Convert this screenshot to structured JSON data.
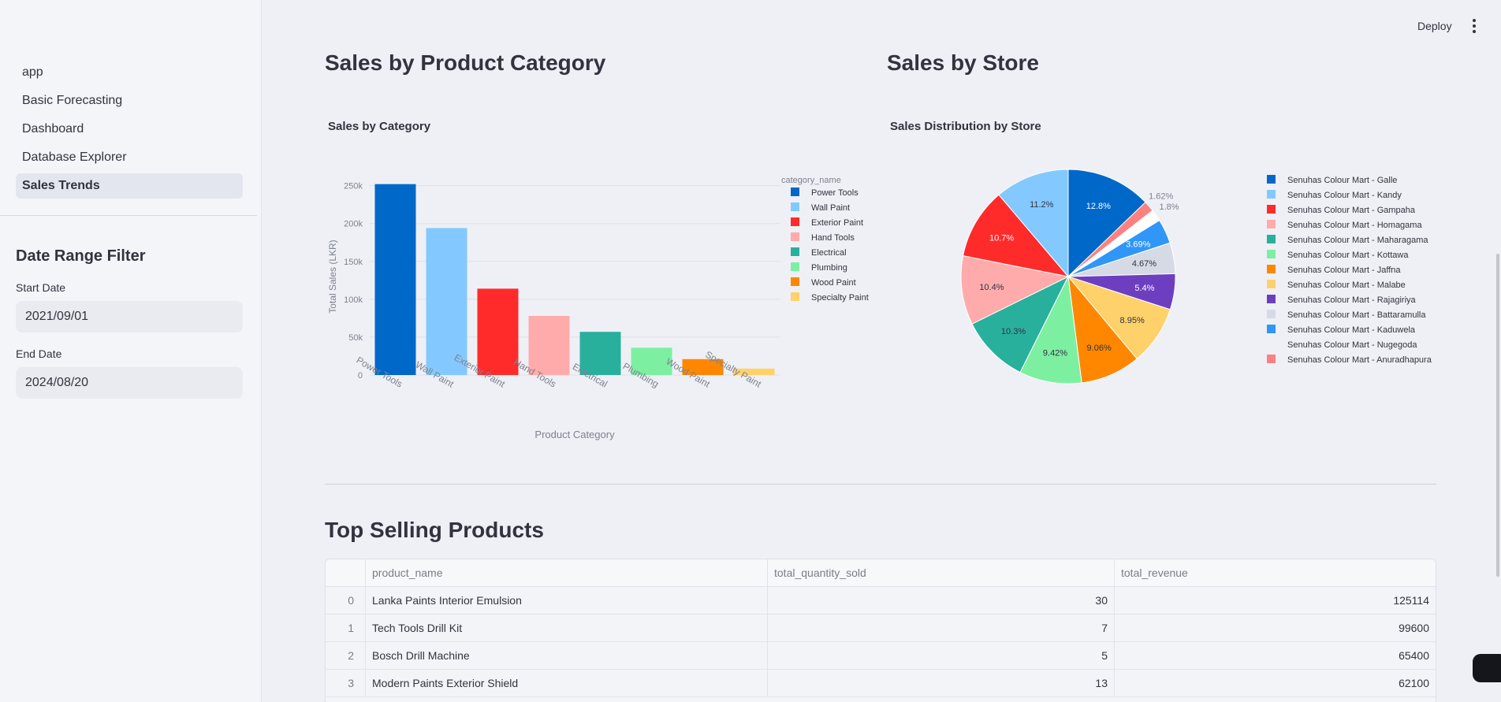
{
  "sidebar": {
    "nav": [
      "app",
      "Basic Forecasting",
      "Dashboard",
      "Database Explorer",
      "Sales Trends"
    ],
    "filter_title": "Date Range Filter",
    "start_label": "Start Date",
    "start_value": "2021/09/01",
    "end_label": "End Date",
    "end_value": "2024/08/20"
  },
  "header": {
    "deploy": "Deploy",
    "menu_icon": "vertical-ellipsis-icon"
  },
  "main": {
    "category_heading": "Sales by Product Category",
    "store_heading": "Sales by Store",
    "top_heading": "Top Selling Products"
  },
  "chart_data": [
    {
      "type": "bar",
      "title": "Sales by Category",
      "xlabel": "Product Category",
      "ylabel": "Total Sales (LKR)",
      "legend_title": "category_name",
      "legend_position": "right",
      "categories": [
        "Power Tools",
        "Wall Paint",
        "Exterior Paint",
        "Hand Tools",
        "Electrical",
        "Plumbing",
        "Wood Paint",
        "Specialty Paint"
      ],
      "values": [
        252000,
        194000,
        114000,
        78000,
        57000,
        36000,
        21000,
        8500
      ],
      "colors": [
        "#0068c9",
        "#83c9ff",
        "#ff2b2b",
        "#ffabab",
        "#29b09d",
        "#7defa1",
        "#ff8700",
        "#ffd16a"
      ],
      "yticks": [
        0,
        50000,
        100000,
        150000,
        200000,
        250000
      ],
      "ytick_labels": [
        "0",
        "50k",
        "100k",
        "150k",
        "200k",
        "250k"
      ],
      "ylim": [
        0,
        260000
      ],
      "grid": true
    },
    {
      "type": "pie",
      "title": "Sales Distribution by Store",
      "legend_position": "right",
      "labels": [
        "Senuhas Colour Mart - Galle",
        "Senuhas Colour Mart - Kandy",
        "Senuhas Colour Mart - Gampaha",
        "Senuhas Colour Mart - Homagama",
        "Senuhas Colour Mart - Maharagama",
        "Senuhas Colour Mart - Kottawa",
        "Senuhas Colour Mart - Jaffna",
        "Senuhas Colour Mart - Malabe",
        "Senuhas Colour Mart - Rajagiriya",
        "Senuhas Colour Mart - Battaramulla",
        "Senuhas Colour Mart - Kaduwela",
        "Senuhas Colour Mart - Nugegoda",
        "Senuhas Colour Mart - Anuradhapura"
      ],
      "colors": [
        "#0068c9",
        "#83c9ff",
        "#ff2b2b",
        "#ffabab",
        "#29b09d",
        "#7defa1",
        "#ff8700",
        "#ffd16a",
        "#6d3fc0",
        "#d5dae5",
        "#3096f8",
        "#ffffff",
        "#fe8080"
      ],
      "pie_order": [
        0,
        12,
        11,
        10,
        9,
        8,
        7,
        6,
        5,
        4,
        3,
        2,
        1
      ],
      "pie_values": [
        12.8,
        1.62,
        1.8,
        3.69,
        4.67,
        5.4,
        8.95,
        9.06,
        9.42,
        10.3,
        10.4,
        10.7,
        11.2
      ],
      "pie_labels": [
        "12.8%",
        "1.62%",
        "1.8%",
        "3.69%",
        "4.67%",
        "5.4%",
        "8.95%",
        "9.06%",
        "9.42%",
        "10.3%",
        "10.4%",
        "10.7%",
        "11.2%"
      ]
    }
  ],
  "table": {
    "columns": [
      "product_name",
      "total_quantity_sold",
      "total_revenue"
    ],
    "rows": [
      {
        "index": "0",
        "product_name": "Lanka Paints Interior Emulsion",
        "total_quantity_sold": "30",
        "total_revenue": "125114"
      },
      {
        "index": "1",
        "product_name": "Tech Tools Drill Kit",
        "total_quantity_sold": "7",
        "total_revenue": "99600"
      },
      {
        "index": "2",
        "product_name": "Bosch Drill Machine",
        "total_quantity_sold": "5",
        "total_revenue": "65400"
      },
      {
        "index": "3",
        "product_name": "Modern Paints Exterior Shield",
        "total_quantity_sold": "13",
        "total_revenue": "62100"
      }
    ]
  }
}
